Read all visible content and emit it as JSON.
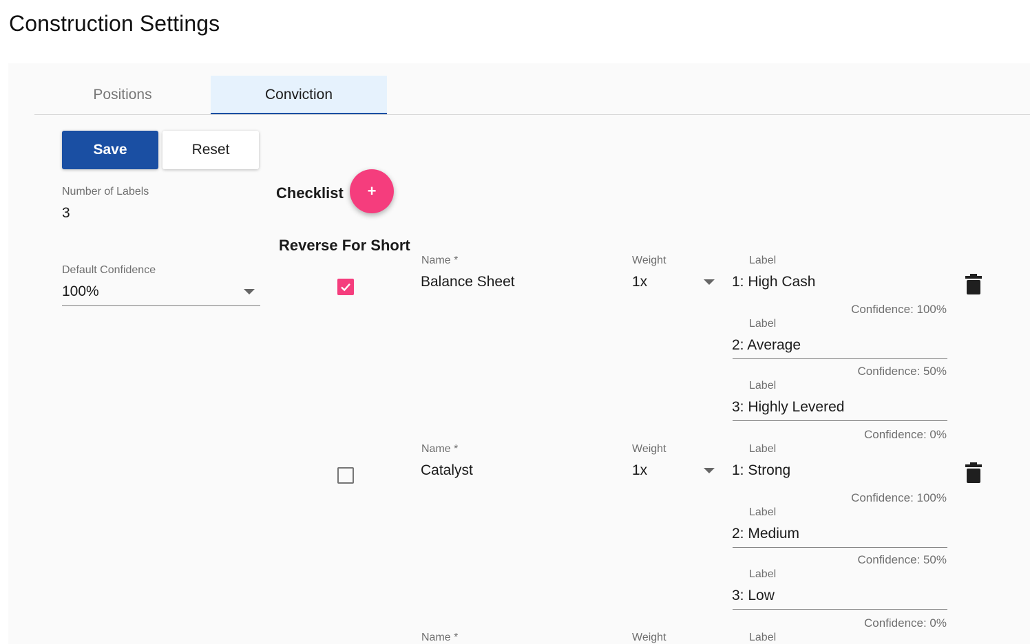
{
  "page_title": "Construction Settings",
  "tabs": [
    {
      "label": "Positions",
      "active": false
    },
    {
      "label": "Conviction",
      "active": true
    }
  ],
  "actions": {
    "save_label": "Save",
    "reset_label": "Reset"
  },
  "number_of_labels": {
    "label": "Number of Labels",
    "value": "3"
  },
  "default_confidence": {
    "label": "Default Confidence",
    "value": "100%"
  },
  "checklist": {
    "title": "Checklist",
    "add_label": "+",
    "reverse_header": "Reverse For Short"
  },
  "field_labels": {
    "name": "Name *",
    "weight": "Weight",
    "label": "Label"
  },
  "items": [
    {
      "reverse_for_short": true,
      "name": "Balance Sheet",
      "weight": "1x",
      "labels": [
        {
          "text": "1: High Cash",
          "confidence": "Confidence: 100%"
        },
        {
          "text": "2: Average",
          "confidence": "Confidence: 50%"
        },
        {
          "text": "3: Highly Levered",
          "confidence": "Confidence: 0%"
        }
      ]
    },
    {
      "reverse_for_short": false,
      "name": "Catalyst",
      "weight": "1x",
      "labels": [
        {
          "text": "1: Strong",
          "confidence": "Confidence: 100%"
        },
        {
          "text": "2: Medium",
          "confidence": "Confidence: 50%"
        },
        {
          "text": "3: Low",
          "confidence": "Confidence: 0%"
        }
      ]
    }
  ],
  "colors": {
    "primary": "#1a4fa3",
    "accent": "#f53d7d",
    "tab_active_bg": "#e6f2fd"
  }
}
